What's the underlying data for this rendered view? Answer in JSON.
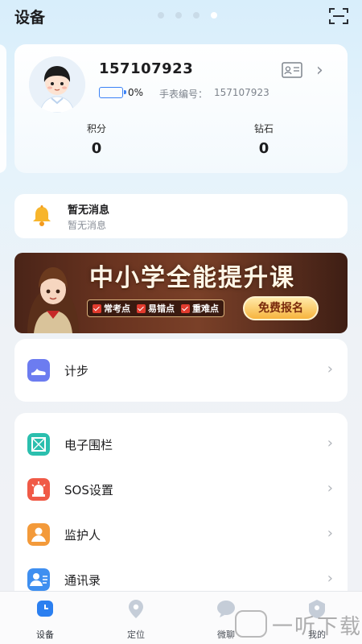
{
  "header": {
    "title": "设备",
    "page_count": 4,
    "active_page": 4
  },
  "profile": {
    "name": "157107923",
    "battery_pct": "0%",
    "watch_label": "手表编号：",
    "watch_no": "157107923",
    "stats": [
      {
        "label": "积分",
        "value": "0"
      },
      {
        "label": "钻石",
        "value": "0"
      }
    ]
  },
  "message": {
    "title": "暂无消息",
    "subtitle": "暂无消息"
  },
  "banner": {
    "headline": "中小学全能提升课",
    "tags": [
      "常考点",
      "易错点",
      "重难点"
    ],
    "cta": "免费报名"
  },
  "menu_step": {
    "label": "计步",
    "icon": "shoe-icon"
  },
  "menu": [
    {
      "label": "电子围栏",
      "icon": "fence-icon",
      "color": "#2bbfae"
    },
    {
      "label": "SOS设置",
      "icon": "alarm-icon",
      "color": "#f05a47"
    },
    {
      "label": "监护人",
      "icon": "guardian-icon",
      "color": "#f39a3a"
    },
    {
      "label": "通讯录",
      "icon": "contacts-icon",
      "color": "#3f8ff0"
    }
  ],
  "tabs": [
    {
      "label": "设备",
      "icon": "watch-icon"
    },
    {
      "label": "定位",
      "icon": "location-pin-icon"
    },
    {
      "label": "微聊",
      "icon": "chat-icon"
    },
    {
      "label": "我的",
      "icon": "profile-icon"
    }
  ],
  "watermark": "一听下载",
  "colors": {
    "accent": "#3b82f6",
    "tab_active": "#2b7ff0"
  }
}
